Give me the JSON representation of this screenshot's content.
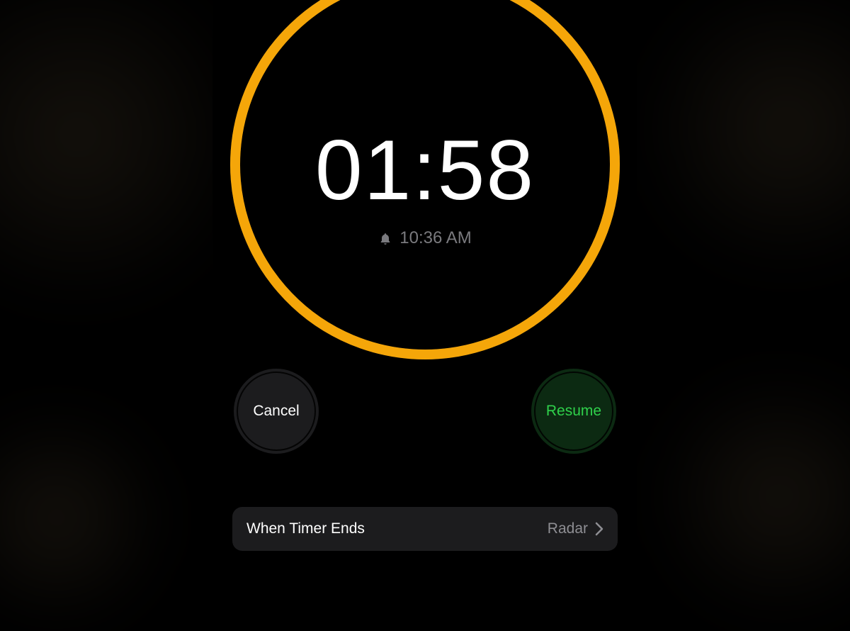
{
  "timer": {
    "remaining_display": "01:58",
    "end_time_display": "10:36 AM",
    "progress_fraction": 0.985
  },
  "buttons": {
    "cancel_label": "Cancel",
    "resume_label": "Resume"
  },
  "when_ends": {
    "label": "When Timer Ends",
    "value": "Radar"
  },
  "colors": {
    "accent": "#f5a609",
    "resume_green": "#2fd14b",
    "track_grey": "#2c2c2e"
  }
}
